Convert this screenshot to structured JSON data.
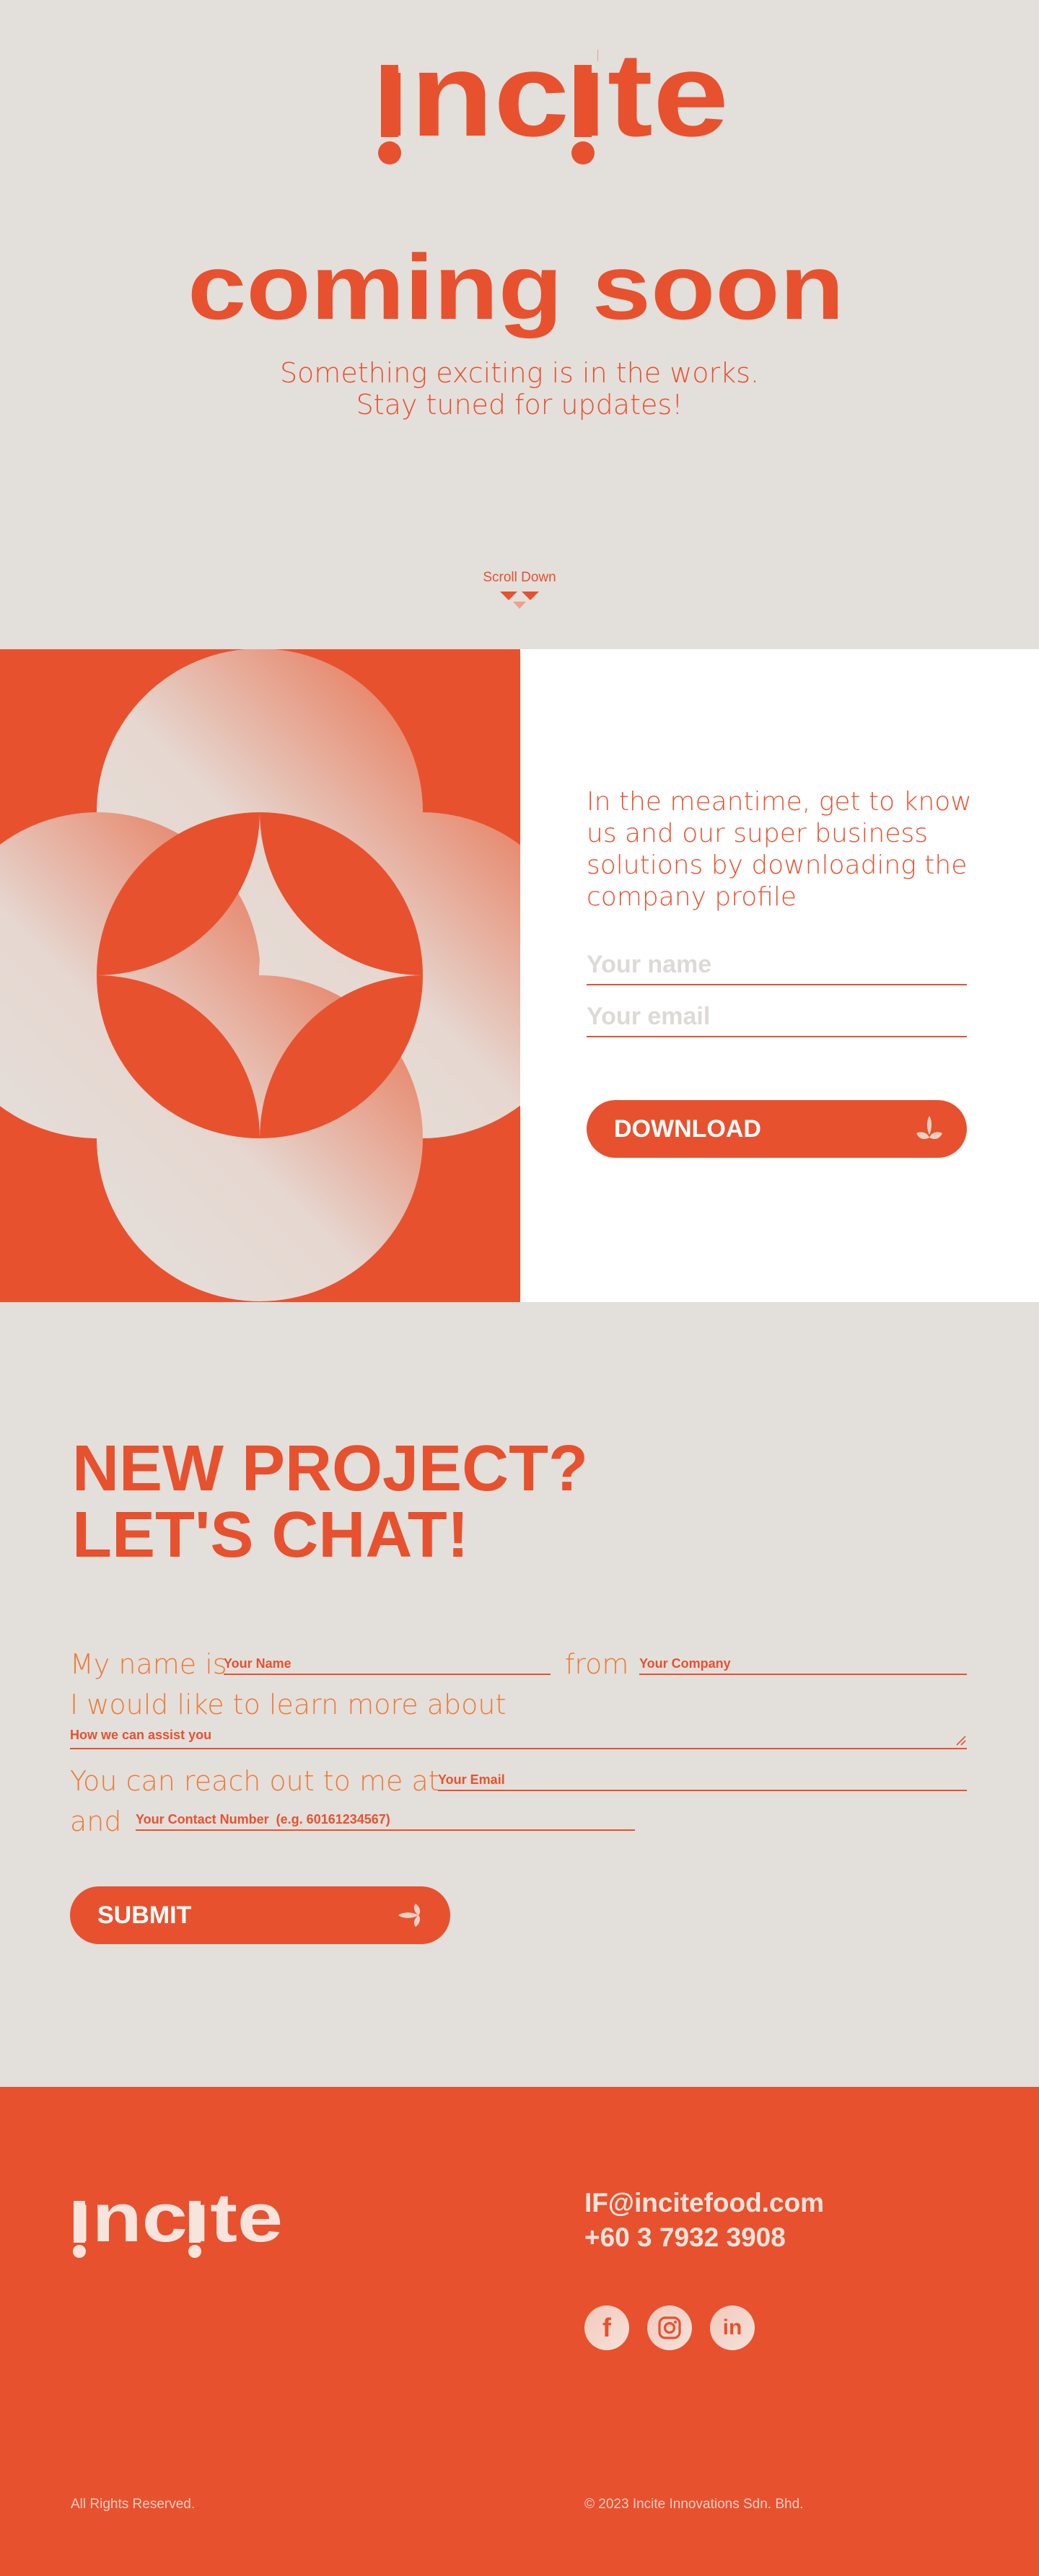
{
  "colors": {
    "accent": "#e8512e",
    "background": "#e3dfdb",
    "panel": "#ffffff",
    "footer_text": "#f6e4dd"
  },
  "brand": {
    "name": "incite"
  },
  "hero": {
    "headline": "coming soon",
    "tagline_line1": "Something exciting is in the works.",
    "tagline_line2": "Stay tuned for updates!",
    "scroll_label": "Scroll Down",
    "scroll_icon": "double-chevron-down-icon"
  },
  "profile": {
    "intro": "In the meantime, get to know us and our super business solutions by downloading the company profile",
    "name_placeholder": "Your name",
    "email_placeholder": "Your email",
    "download_label": "DOWNLOAD",
    "download_icon": "sprout-icon"
  },
  "chat": {
    "title_line1": "NEW PROJECT?",
    "title_line2": "LET'S CHAT!",
    "my_name_is": "My name is",
    "name_placeholder": "Your Name",
    "from": "from",
    "company_placeholder": "Your Company",
    "learn_more": "I would like to learn more about",
    "assist_placeholder": "How we can assist you",
    "reach_out": "You can reach out to me at",
    "email_placeholder": "Your Email",
    "and": "and",
    "contact_placeholder": "Your Contact Number  (e.g. 60161234567)",
    "submit_label": "SUBMIT",
    "submit_icon": "sprout-icon"
  },
  "footer": {
    "email": "IF@incitefood.com",
    "phone": "+60 3 7932 3908",
    "social": [
      {
        "icon": "facebook-icon",
        "glyph": "f"
      },
      {
        "icon": "instagram-icon",
        "glyph": ""
      },
      {
        "icon": "linkedin-icon",
        "glyph": "in"
      }
    ],
    "rights": "All Rights Reserved.",
    "copyright": "© 2023 Incite Innovations Sdn. Bhd."
  }
}
